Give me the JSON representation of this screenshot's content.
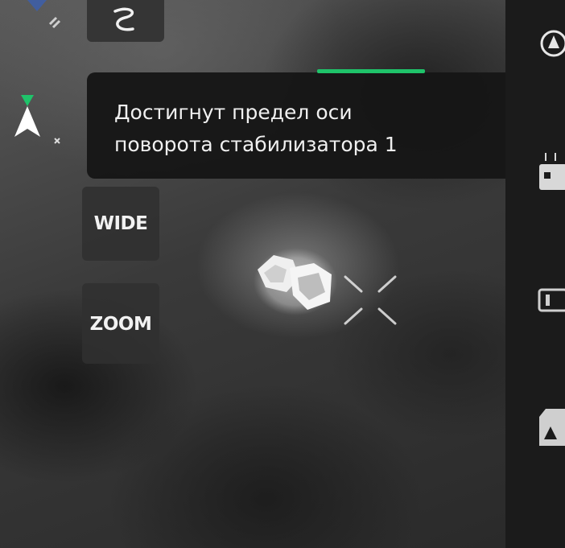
{
  "gimbal_toast": {
    "message": "Достигнут предел оси\nповорота стабилизатора 1"
  },
  "camera_modes": {
    "wide_label": "WIDE",
    "zoom_label": "ZOOM"
  },
  "icons": {
    "top_left": "satellite-icon",
    "top_button": "snake-path-icon",
    "nav": "aircraft-heading-icon",
    "right_panel": [
      "auto-exposure-icon",
      "camera-settings-icon",
      "hd-quality-icon",
      "sd-card-icon"
    ],
    "target": "crosshair-icon"
  },
  "colors": {
    "accent_green": "#1fc36a",
    "panel": "#1b1b1b",
    "toast_bg": "#161616"
  }
}
